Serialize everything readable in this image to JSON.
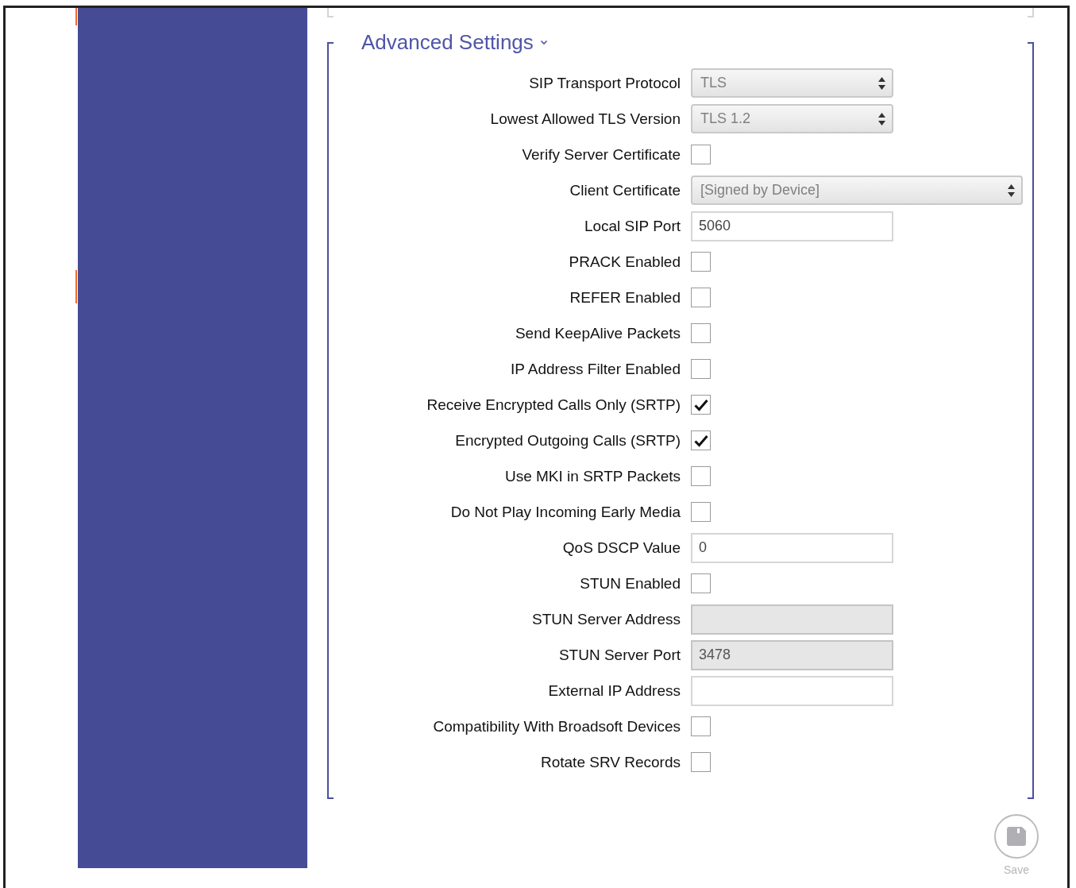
{
  "section": {
    "title": "Advanced Settings",
    "expanded": true
  },
  "fields": [
    {
      "kind": "select",
      "label": "SIP Transport Protocol",
      "value": "TLS",
      "wide": false
    },
    {
      "kind": "select",
      "label": "Lowest Allowed TLS Version",
      "value": "TLS 1.2",
      "wide": false
    },
    {
      "kind": "checkbox",
      "label": "Verify Server Certificate",
      "checked": false
    },
    {
      "kind": "select",
      "label": "Client Certificate",
      "value": "[Signed by Device]",
      "wide": true
    },
    {
      "kind": "text",
      "label": "Local SIP Port",
      "value": "5060",
      "disabled": false
    },
    {
      "kind": "checkbox",
      "label": "PRACK Enabled",
      "checked": false
    },
    {
      "kind": "checkbox",
      "label": "REFER Enabled",
      "checked": false
    },
    {
      "kind": "checkbox",
      "label": "Send KeepAlive Packets",
      "checked": false
    },
    {
      "kind": "checkbox",
      "label": "IP Address Filter Enabled",
      "checked": false
    },
    {
      "kind": "checkbox",
      "label": "Receive Encrypted Calls Only (SRTP)",
      "checked": true
    },
    {
      "kind": "checkbox",
      "label": "Encrypted Outgoing Calls (SRTP)",
      "checked": true
    },
    {
      "kind": "checkbox",
      "label": "Use MKI in SRTP Packets",
      "checked": false
    },
    {
      "kind": "checkbox",
      "label": "Do Not Play Incoming Early Media",
      "checked": false
    },
    {
      "kind": "text",
      "label": "QoS DSCP Value",
      "value": "0",
      "disabled": false
    },
    {
      "kind": "checkbox",
      "label": "STUN Enabled",
      "checked": false
    },
    {
      "kind": "text",
      "label": "STUN Server Address",
      "disabled": true
    },
    {
      "kind": "text",
      "label": "STUN Server Port",
      "value": "3478",
      "disabled": true
    },
    {
      "kind": "text",
      "label": "External IP Address",
      "disabled": false
    },
    {
      "kind": "checkbox",
      "label": "Compatibility With Broadsoft Devices",
      "checked": false
    },
    {
      "kind": "checkbox",
      "label": "Rotate SRV Records",
      "checked": false
    }
  ],
  "save_button": {
    "label": "Save",
    "disabled": true
  }
}
